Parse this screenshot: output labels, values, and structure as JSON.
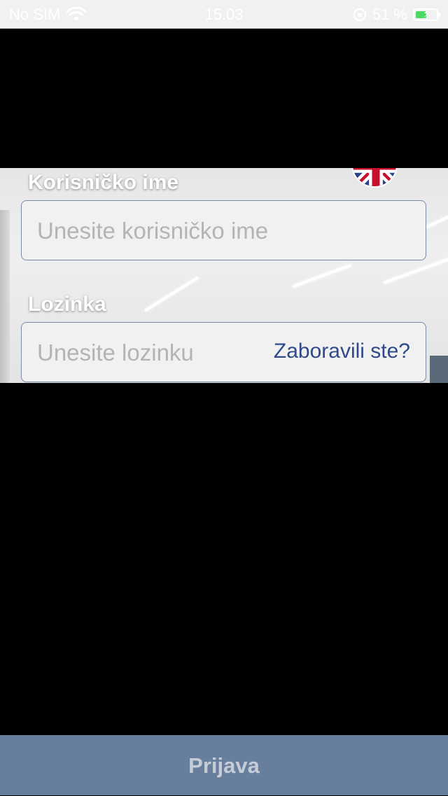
{
  "status_bar": {
    "carrier": "No SIM",
    "time": "15.03",
    "battery_percent": "51 %",
    "battery_level": 0.51,
    "battery_color": "#4cd964"
  },
  "login": {
    "language_flag": "uk-flag-icon",
    "username_label": "Korisničko ime",
    "username_placeholder": "Unesite korisničko ime",
    "password_label": "Lozinka",
    "password_placeholder": "Unesite lozinku",
    "forgot_password": "Zaboravili ste?"
  },
  "footer": {
    "login_button": "Prijava",
    "button_color": "#677e9c"
  }
}
